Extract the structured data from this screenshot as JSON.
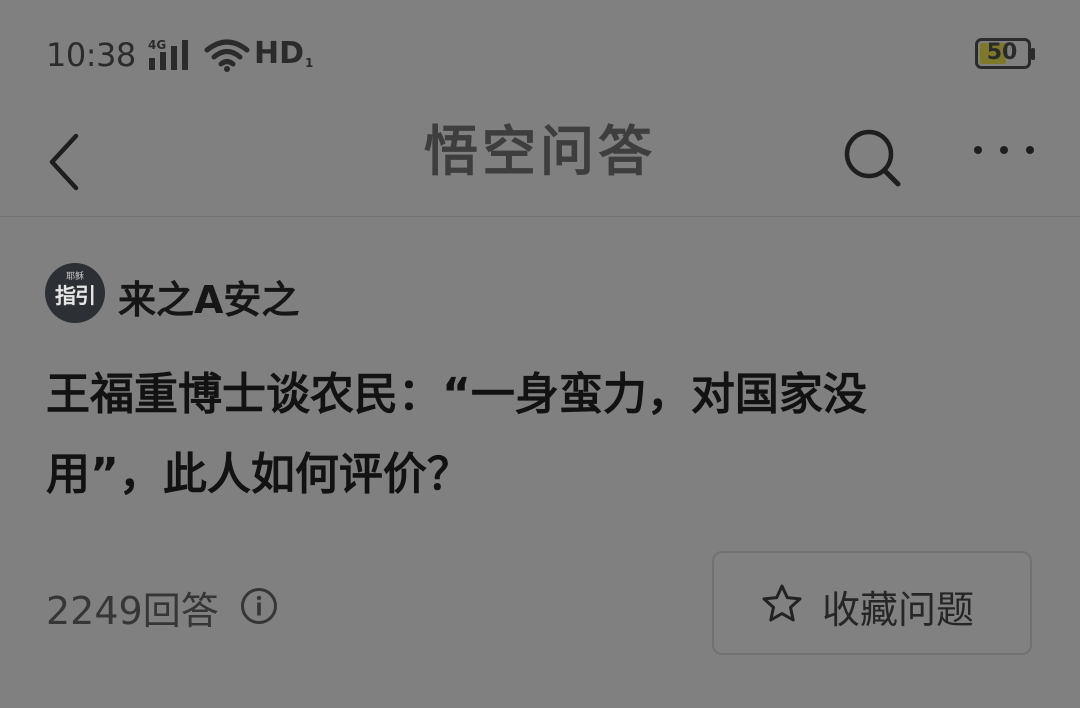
{
  "status_bar": {
    "time": "10:38",
    "network": "4G",
    "hd_label": "HD",
    "hd_sub": "1",
    "battery": "50",
    "icons": [
      "signal-icon",
      "wifi-icon",
      "battery-icon"
    ]
  },
  "nav": {
    "back_icon": "chevron-left-icon",
    "title": "悟空问答",
    "search_icon": "search-icon",
    "more_icon": "more-dots-icon"
  },
  "author": {
    "avatar_text_top": "耶稣",
    "avatar_text_main": "指引",
    "name": "来之A安之"
  },
  "question": {
    "title": "王福重博士谈农民：“一身蛮力，对国家没用”，此人如何评价？"
  },
  "footer": {
    "answer_count": "2249回答",
    "info_icon": "info-icon",
    "favorite_label": "收藏问题",
    "favorite_icon": "star-icon"
  },
  "colors": {
    "background": "#808080",
    "text": "#1c1c1c",
    "border": "#727272"
  }
}
